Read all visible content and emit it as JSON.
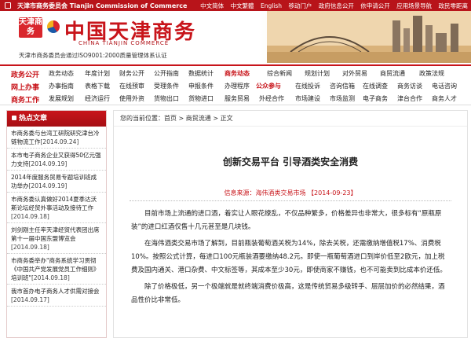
{
  "topbar": {
    "org": "天津市商务委员会  Tianjin Commission of Commerce",
    "links": [
      "中文简体",
      "中文繁體",
      "English",
      "移动门户",
      "政府信息公开",
      "依申请公开",
      "应用场景导航",
      "政民零距离"
    ]
  },
  "banner": {
    "logo_text": "天津商务",
    "site_name": "中国天津商务",
    "site_sub": "CHINA TIANJIN COMMERCE",
    "cert": "天津市商务委员会通过ISO9001:2000质量管理体系认证"
  },
  "nav": {
    "rows": [
      {
        "category": "政务公开",
        "items": [
          "政务动态",
          "年度计划",
          "财务公开",
          "公开指南",
          "数据统计",
          "商务动态",
          "综合新闻",
          "规划计划",
          "对外贸易",
          "商贸流通",
          "政策法规"
        ],
        "highlight": 5
      },
      {
        "category": "网上办事",
        "items": [
          "办事指南",
          "表格下载",
          "在线预审",
          "受理条件",
          "申报条件",
          "办理程序",
          "公众参与",
          "在线投诉",
          "咨询信箱",
          "在线调查",
          "商务访谈",
          "电话咨询"
        ],
        "highlight": 6
      },
      {
        "category": "商务工作",
        "items": [
          "发展规划",
          "经济运行",
          "使用外资",
          "货物出口",
          "货物进口",
          "服务贸易",
          "外经合作",
          "市场建设",
          "市场监测",
          "电子商务",
          "津台合作",
          "商务人才"
        ],
        "highlight": -1
      }
    ]
  },
  "sidebar": {
    "heading": "热点文章",
    "items": [
      {
        "title": "市商务委与台湾工研院研究津台冷链物流工作",
        "date": "[2014.09.24]"
      },
      {
        "title": "本市电子商务企业又获得50亿元强力支持",
        "date": "[2014.09.19]"
      },
      {
        "title": "2014年度服务贸易专题培训班成功举办",
        "date": "[2014.09.19]"
      },
      {
        "title": "市商务委认真做好2014夏季达沃斯论坛经贸外事活动及接待工作",
        "date": "[2014.09.18]"
      },
      {
        "title": "刘剑刚主任率天津经贸代表团出席第十一届中国东盟博览会",
        "date": "[2014.09.18]"
      },
      {
        "title": "市商务委举办\"商务系统学习贯彻《中国共产党发展党员工作细则》培训班\"",
        "date": "[2014.09.18]"
      },
      {
        "title": "我市首办电子商务人才供需对接会",
        "date": "[2014.09.17]"
      }
    ]
  },
  "breadcrumb": "您的当前位置：首页 > 商贸流通 > 正文",
  "article": {
    "title": "创新交易平台 引导酒类安全消费",
    "source": "信息来源：海伟酒类交易市场 【2014-09-23】",
    "paragraphs": [
      "目前市场上流通的进口酒，着实让人眼花缭乱，不仅品种繁多，价格差异也非常大，很多标有“原瓶原装”的进口红酒仅售十几元甚至是几块钱。",
      "在海伟酒类交易市场了解到，目前瓶装葡萄酒关税为14%，除去关税，还需缴纳增值税17%、消费税10%。按照公式计算，每进口100元瓶装酒要缴纳48.2元。即使一瓶葡萄酒进口到岸价低至2欧元，加上税费及国内通关、港口杂费、中文标签等，其成本至少30元，即使商家不赚钱，也不可能卖到比成本价还低。",
      "除了价格极低，另一个极端就是就终端消费价极高，这是传统贸易多级转手、层层加价的必然结果，酒品性价比非常低。"
    ]
  },
  "colors": {
    "accent": "#c8141a",
    "topbar": "#b8141a"
  }
}
